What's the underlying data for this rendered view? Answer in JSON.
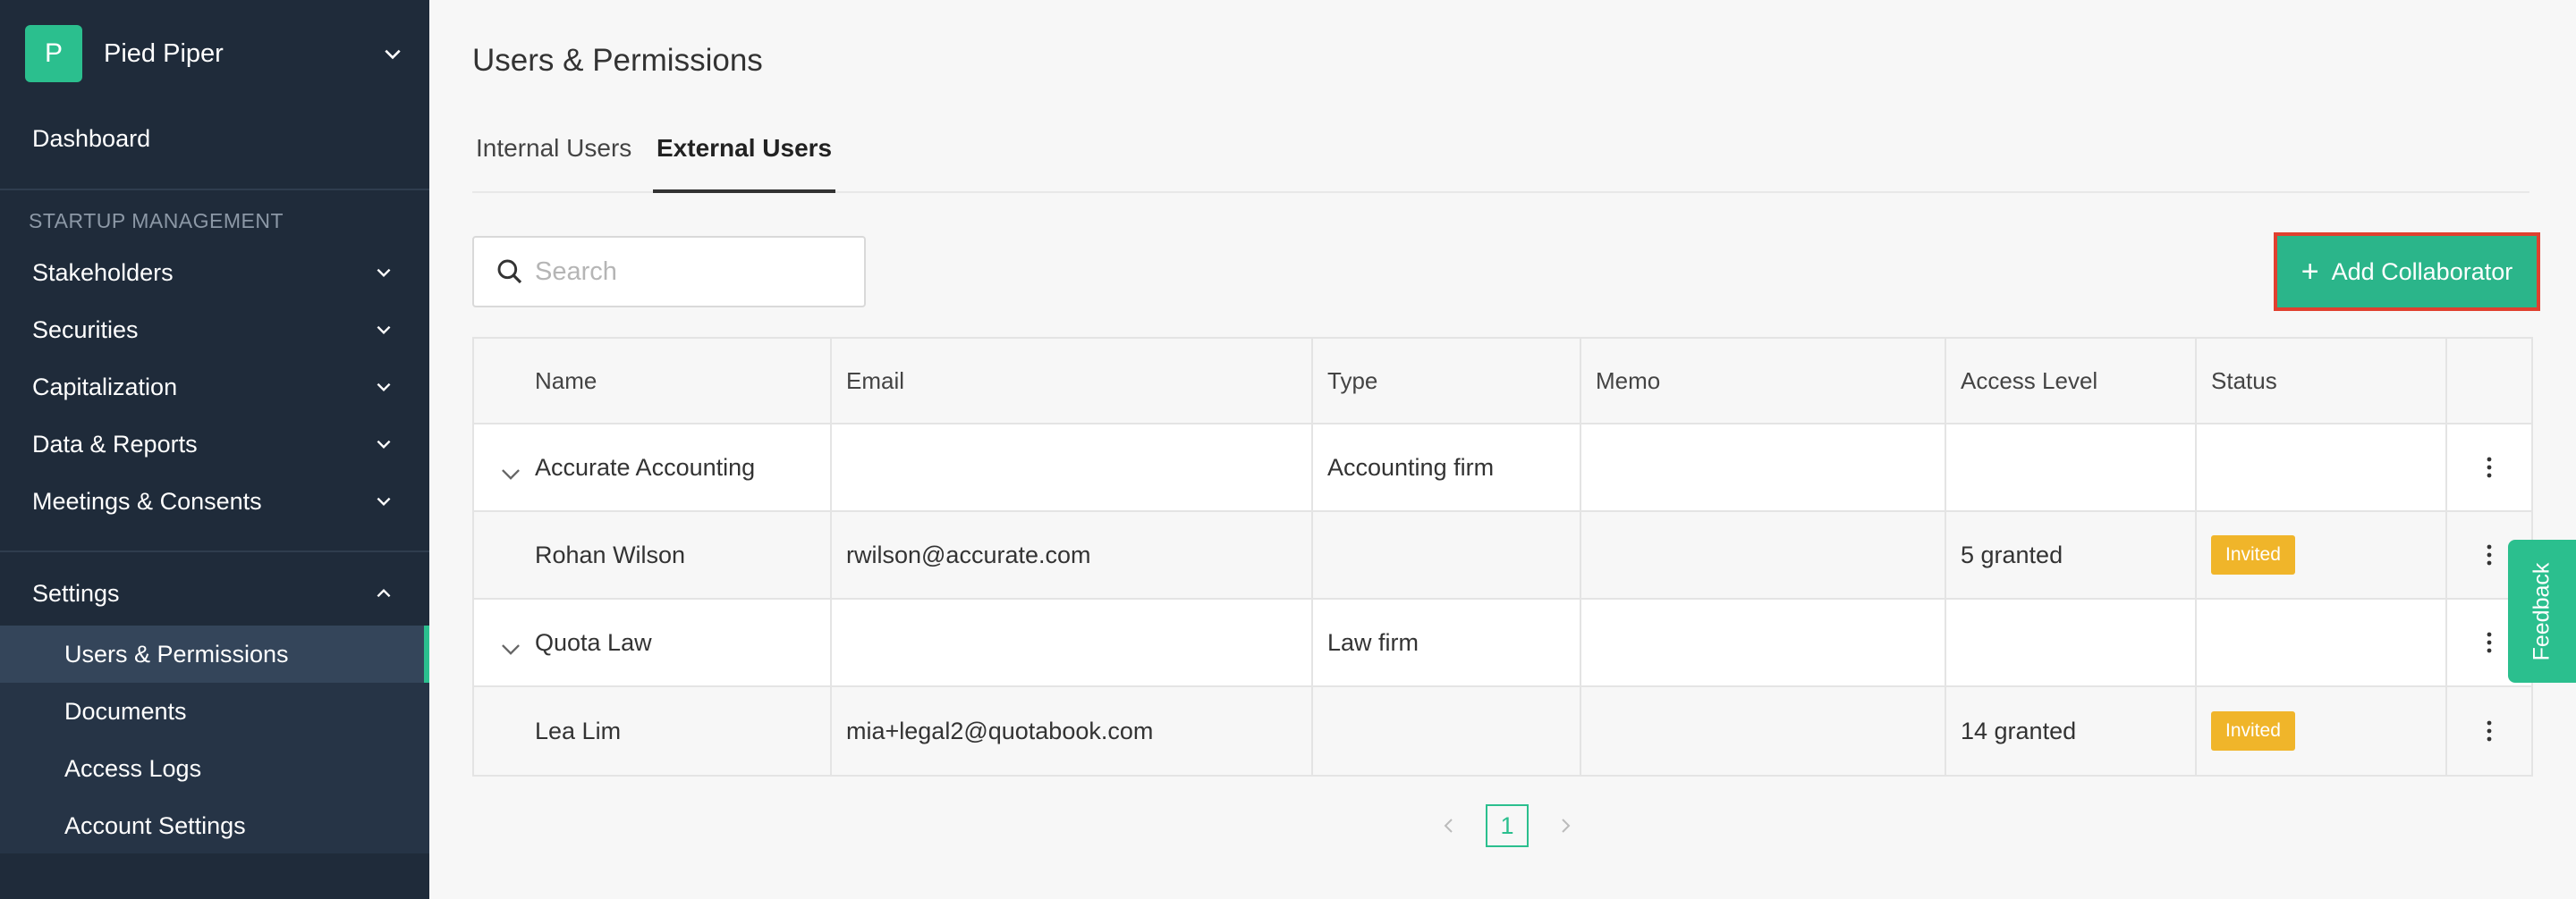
{
  "sidebar": {
    "org": {
      "initial": "P",
      "name": "Pied Piper"
    },
    "dashboard": "Dashboard",
    "section_title": "STARTUP MANAGEMENT",
    "items": [
      {
        "label": "Stakeholders"
      },
      {
        "label": "Securities"
      },
      {
        "label": "Capitalization"
      },
      {
        "label": "Data & Reports"
      },
      {
        "label": "Meetings & Consents"
      }
    ],
    "settings": {
      "label": "Settings",
      "children": [
        {
          "label": "Users & Permissions"
        },
        {
          "label": "Documents"
        },
        {
          "label": "Access Logs"
        },
        {
          "label": "Account Settings"
        }
      ]
    }
  },
  "main": {
    "title": "Users & Permissions",
    "tabs": [
      {
        "label": "Internal Users"
      },
      {
        "label": "External Users"
      }
    ],
    "search": {
      "placeholder": "Search",
      "value": ""
    },
    "add_button": {
      "label": "Add Collaborator"
    },
    "table": {
      "columns": [
        "Name",
        "Email",
        "Type",
        "Memo",
        "Access Level",
        "Status"
      ],
      "rows": [
        {
          "name": "Accurate Accounting",
          "email": "",
          "type": "Accounting firm",
          "memo": "",
          "access": "",
          "status": ""
        },
        {
          "name": "Rohan Wilson",
          "email": "rwilson@accurate.com",
          "type": "",
          "memo": "",
          "access": "5 granted",
          "status": "Invited"
        },
        {
          "name": "Quota Law",
          "email": "",
          "type": "Law firm",
          "memo": "",
          "access": "",
          "status": ""
        },
        {
          "name": "Lea Lim",
          "email": "mia+legal2@quotabook.com",
          "type": "",
          "memo": "",
          "access": "14 granted",
          "status": "Invited"
        }
      ]
    },
    "pagination": {
      "current": "1"
    },
    "feedback": "Feedback"
  },
  "colors": {
    "accent": "#2bbf8e",
    "sidebar": "#1f2b3a",
    "badge": "#f0b52a",
    "highlight": "#e0402f"
  }
}
